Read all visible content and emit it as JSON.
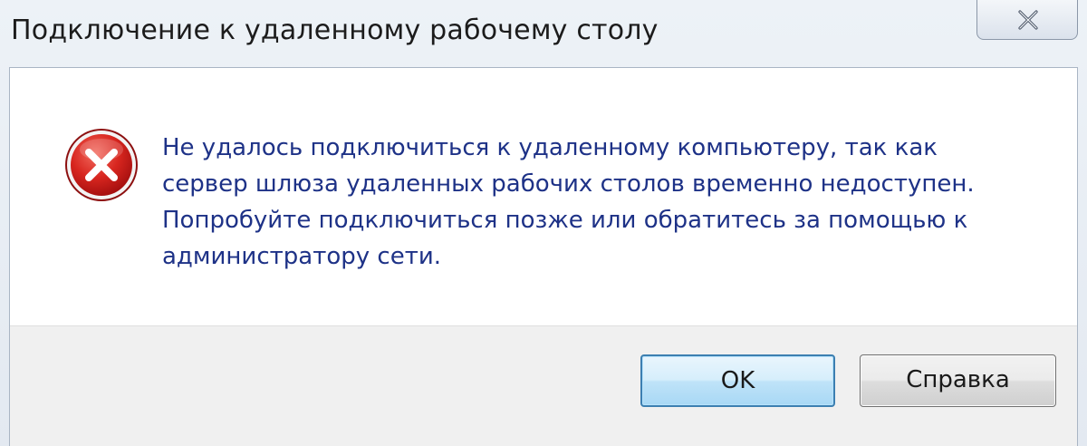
{
  "window": {
    "title": "Подключение к удаленному рабочему столу",
    "close_icon": "close-icon"
  },
  "dialog": {
    "icon": "error-icon",
    "message": "Не удалось подключиться к удаленному компьютеру, так как\nсервер шлюза удаленных рабочих столов временно недоступен.\nПопробуйте подключиться позже или обратитесь за помощью к\nадминистратору сети."
  },
  "buttons": {
    "ok_label": "OK",
    "help_label": "Справка"
  },
  "colors": {
    "message_text": "#1e3287",
    "error_red": "#d62020",
    "ok_border": "#3c7fb1"
  }
}
